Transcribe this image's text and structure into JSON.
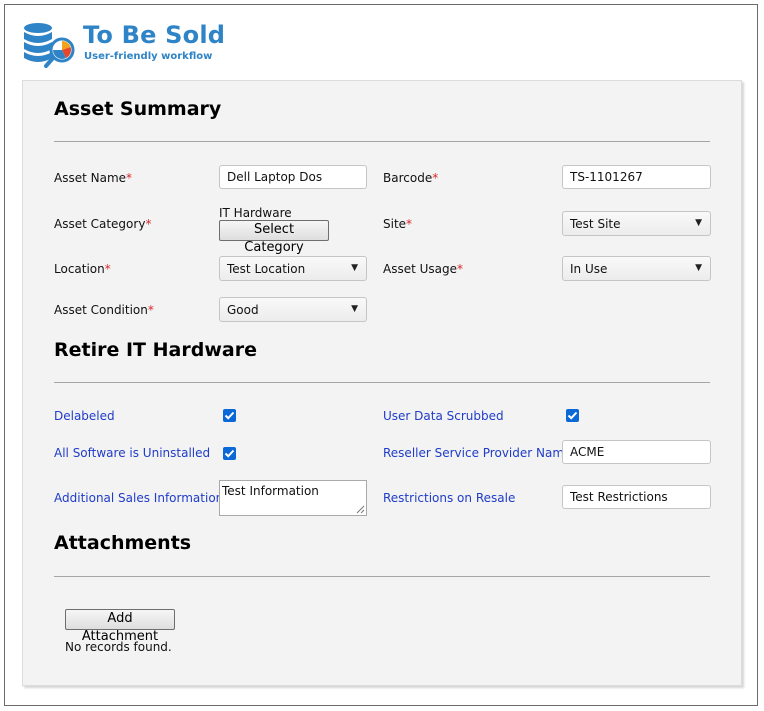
{
  "header": {
    "title": "To Be Sold",
    "subtitle": "User-friendly workflow",
    "logo_icon": "database-chart-search-icon"
  },
  "sections": {
    "asset_summary": "Asset Summary",
    "retire": "Retire IT Hardware",
    "attachments": "Attachments"
  },
  "fields": {
    "asset_name": {
      "label": "Asset Name",
      "required_mark": "*",
      "value": "Dell Laptop Dos"
    },
    "barcode": {
      "label": "Barcode",
      "required_mark": "*",
      "value": "TS-1101267"
    },
    "asset_category": {
      "label": "Asset Category",
      "required_mark": "*",
      "value": "IT Hardware",
      "button": "Select Category"
    },
    "site": {
      "label": "Site",
      "required_mark": "*",
      "value": "Test Site"
    },
    "location": {
      "label": "Location",
      "required_mark": "*",
      "value": "Test Location"
    },
    "asset_usage": {
      "label": "Asset Usage",
      "required_mark": "*",
      "value": "In Use"
    },
    "asset_condition": {
      "label": "Asset Condition",
      "required_mark": "*",
      "value": "Good"
    }
  },
  "retire": {
    "delabeled": {
      "label": "Delabeled",
      "checked": true
    },
    "user_data_scrubbed": {
      "label": "User Data Scrubbed",
      "checked": true
    },
    "software_uninstalled": {
      "label": "All Software is Uninstalled",
      "checked": true
    },
    "reseller": {
      "label": "Reseller Service Provider Name",
      "value": "ACME"
    },
    "additional_sales": {
      "label": "Additional Sales Information",
      "value": "Test Information"
    },
    "restrictions": {
      "label": "Restrictions on Resale",
      "value": "Test Restrictions"
    }
  },
  "attachments": {
    "add_button": "Add Attachment",
    "empty_message": "No records found."
  },
  "colors": {
    "brand": "#2e84c6",
    "required": "#d9262a",
    "link_label": "#1f3cc8",
    "checkbox": "#0a69d6"
  }
}
